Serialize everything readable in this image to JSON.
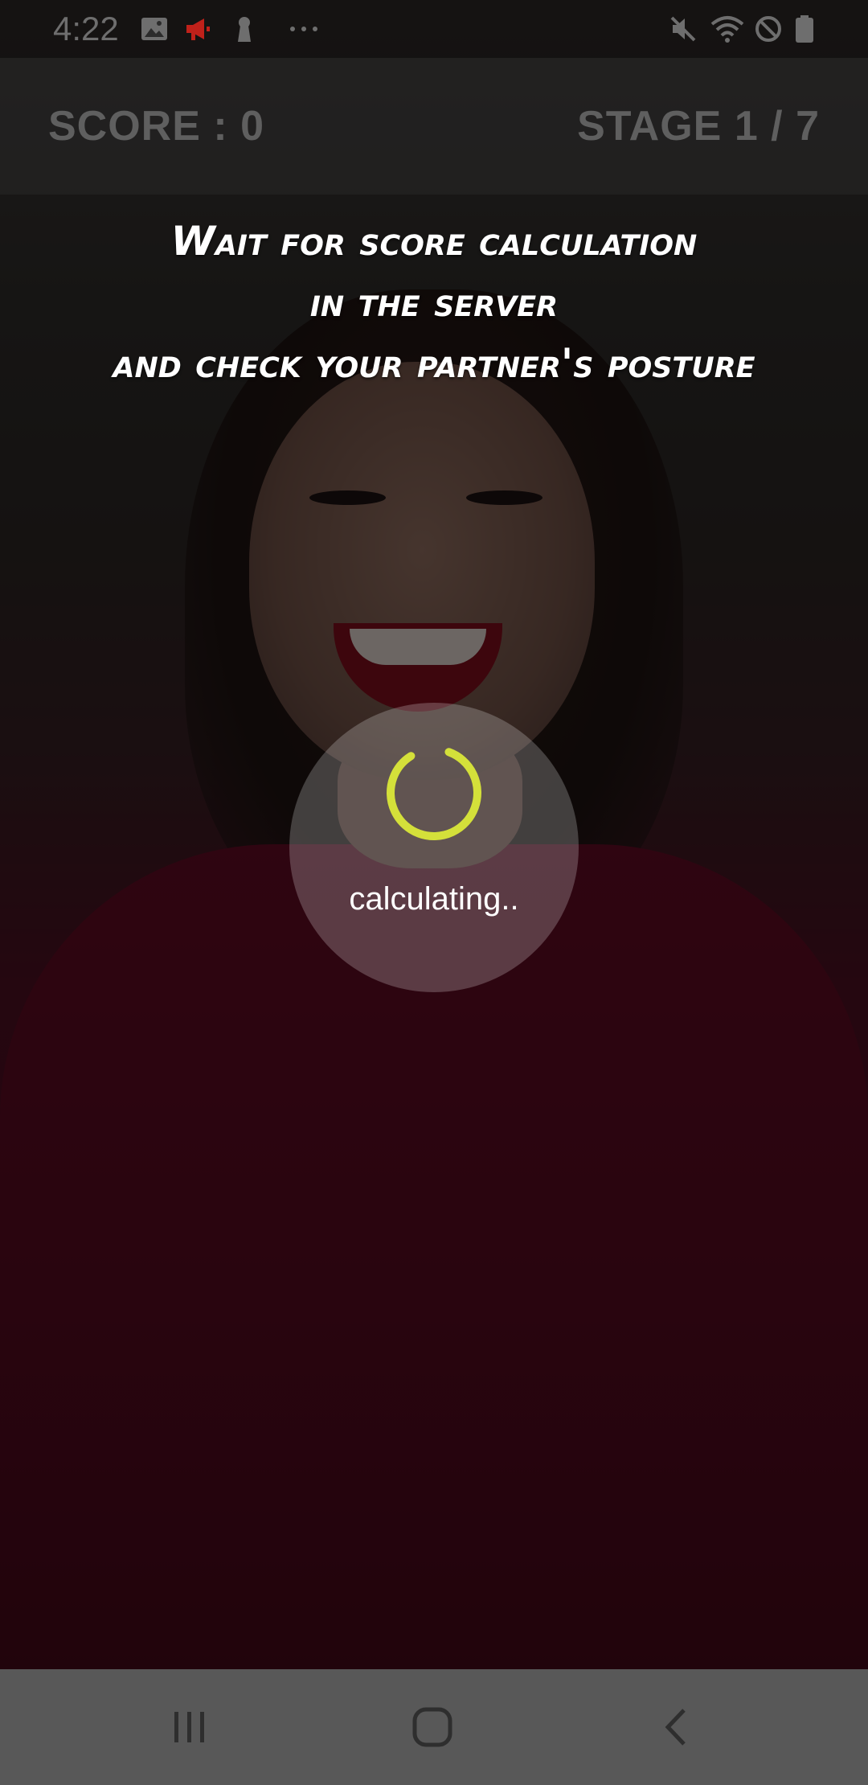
{
  "status_bar": {
    "time": "4:22",
    "left_icons": [
      "image-icon",
      "megaphone-icon",
      "keyhole-icon",
      "more-dots-icon"
    ],
    "right_icons": [
      "mute-icon",
      "wifi-icon",
      "block-icon",
      "battery-icon"
    ],
    "accent_notification": "#c0211a"
  },
  "header": {
    "score_label": "SCORE : 0",
    "stage_label": "STAGE 1 / 7"
  },
  "instruction": {
    "lines": [
      "Wait for score calculation",
      "in the server",
      "and check your partner's posture"
    ]
  },
  "loader": {
    "text": "calculating..",
    "spinner_color": "#d4e03a"
  },
  "nav_bar": {
    "buttons": [
      "recent-apps-icon",
      "home-icon",
      "back-icon"
    ]
  }
}
